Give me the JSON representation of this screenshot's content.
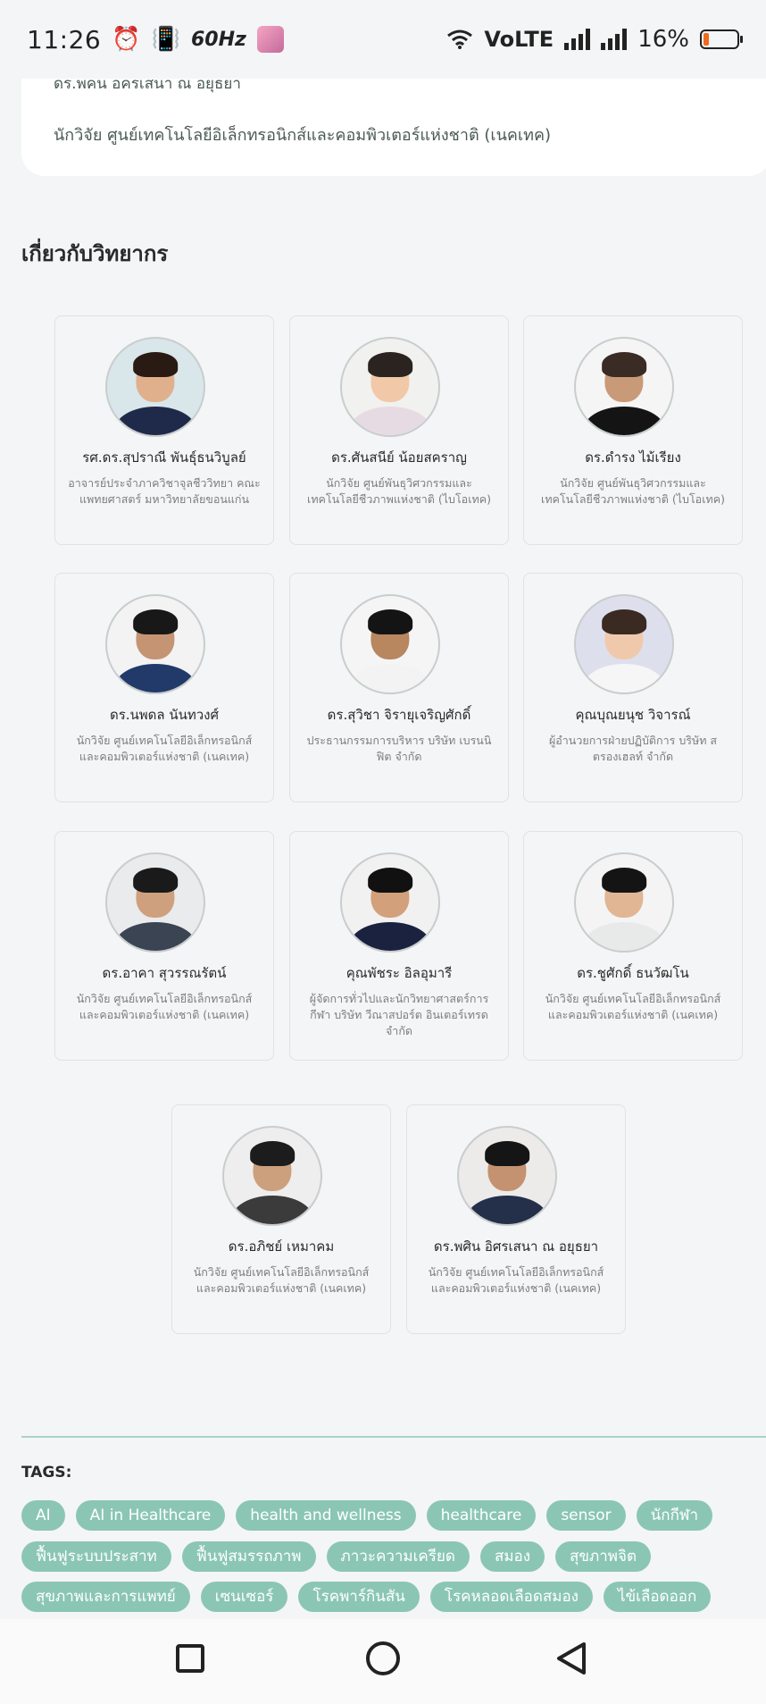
{
  "status_bar": {
    "time": "11:26",
    "refresh": "60Hz",
    "network": "VoLTE",
    "battery": "16%",
    "battery_level": 0.16,
    "icons": [
      "alarm-icon",
      "vibrate-icon",
      "wifi-icon",
      "signal-icon",
      "battery-icon"
    ]
  },
  "organizer": {
    "name_line": "ดร.พคน อครเสนา ณ อยุธยา",
    "affiliation": "นักวิจัย ศูนย์เทคโนโลยีอิเล็กทรอนิกส์และคอมพิวเตอร์แห่งชาติ (เนคเทค)"
  },
  "speakers_section": {
    "title": "เกี่ยวกับวิทยากร",
    "speakers": [
      {
        "name": "รศ.ดร.สุปราณี พันธุ์ธนวิบูลย์",
        "desc": "อาจารย์ประจำภาควิชาจุลชีววิทยา คณะแพทยศาสตร์ มหาวิทยาลัยขอนแก่น"
      },
      {
        "name": "ดร.ศันสนีย์ น้อยสคราญ",
        "desc": "นักวิจัย ศูนย์พันธุวิศวกรรมและเทคโนโลยีชีวภาพแห่งชาติ (ไบโอเทค)"
      },
      {
        "name": "ดร.ดำรง ไม้เรียง",
        "desc": "นักวิจัย ศูนย์พันธุวิศวกรรมและเทคโนโลยีชีวภาพแห่งชาติ (ไบโอเทค)"
      },
      {
        "name": "ดร.นพดล นันทวงศ์",
        "desc": "นักวิจัย ศูนย์เทคโนโลยีอิเล็กทรอนิกส์และคอมพิวเตอร์แห่งชาติ (เนคเทค)"
      },
      {
        "name": "ดร.สุวิชา จิรายุเจริญศักดิ์",
        "desc": "ประธานกรรมการบริหาร บริษัท เบรนนิฟิต จำกัด"
      },
      {
        "name": "คุณบุณยนุช วิจารณ์",
        "desc": "ผู้อำนวยการฝ่ายปฏิบัติการ บริษัท สตรองเฮลท์ จำกัด"
      },
      {
        "name": "ดร.อาคา สุวรรณรัตน์",
        "desc": "นักวิจัย ศูนย์เทคโนโลยีอิเล็กทรอนิกส์และคอมพิวเตอร์แห่งชาติ (เนคเทค)"
      },
      {
        "name": "คุณพัชระ อิลอุมารี",
        "desc": "ผู้จัดการทั่วไปและนักวิทยาศาสตร์การกีฬา บริษัท วีณาสปอร์ต อินเตอร์เทรด จำกัด"
      },
      {
        "name": "ดร.ชูศักดิ์ ธนวัฒโน",
        "desc": "นักวิจัย ศูนย์เทคโนโลยีอิเล็กทรอนิกส์และคอมพิวเตอร์แห่งชาติ (เนคเทค)"
      },
      {
        "name": "ดร.อภิชย์ เหมาคม",
        "desc": "นักวิจัย ศูนย์เทคโนโลยีอิเล็กทรอนิกส์และคอมพิวเตอร์แห่งชาติ (เนคเทค)"
      },
      {
        "name": "ดร.พศิน อิศรเสนา ณ อยุธยา",
        "desc": "นักวิจัย ศูนย์เทคโนโลยีอิเล็กทรอนิกส์และคอมพิวเตอร์แห่งชาติ (เนคเทค)"
      }
    ]
  },
  "tags": {
    "label": "TAGS:",
    "items": [
      "AI",
      "AI in Healthcare",
      "health and wellness",
      "healthcare",
      "sensor",
      "นักกีฬา",
      "ฟื้นฟูระบบประสาท",
      "ฟื้นฟูสมรรถภาพ",
      "ภาวะความเครียด",
      "สมอง",
      "สุขภาพจิต",
      "สุขภาพและการแพทย์",
      "เซนเซอร์",
      "โรคพาร์กินสัน",
      "โรคหลอดเลือดสมอง",
      "ไข้เลือดออก"
    ]
  },
  "nav_bar": {
    "buttons": [
      "recent-apps-button",
      "home-button",
      "back-button"
    ]
  }
}
